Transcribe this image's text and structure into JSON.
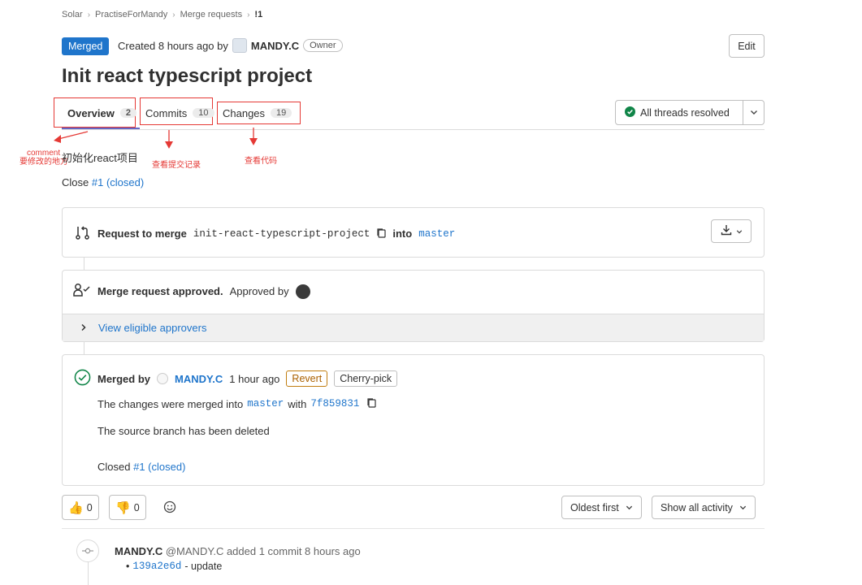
{
  "breadcrumb": [
    "Solar",
    "PractiseForMandy",
    "Merge requests",
    "!1"
  ],
  "header": {
    "status_badge": "Merged",
    "created_text": "Created 8 hours ago by",
    "author": "MANDY.C",
    "role": "Owner",
    "edit_label": "Edit",
    "title": "Init react typescript project"
  },
  "tabs": [
    {
      "label": "Overview",
      "count": "2"
    },
    {
      "label": "Commits",
      "count": "10"
    },
    {
      "label": "Changes",
      "count": "19"
    }
  ],
  "threads_label": "All threads resolved",
  "annotations": {
    "comment_line1": "comment",
    "comment_line2": "要修改的地方",
    "commits_note": "查看提交记录",
    "changes_note": "查看代码"
  },
  "description": "初始化react项目",
  "close_prefix": "Close",
  "close_link": "#1 (closed)",
  "request": {
    "prefix": "Request to merge",
    "source_branch": "init-react-typescript-project",
    "into": "into",
    "target_branch": "master"
  },
  "approval": {
    "title": "Merge request approved.",
    "approved_by": "Approved by",
    "eligible": "View eligible approvers"
  },
  "merged": {
    "merged_by": "Merged by",
    "user": "MANDY.C",
    "time": "1 hour ago",
    "revert_label": "Revert",
    "cherry_label": "Cherry-pick",
    "merged_into_text": "The changes were merged into",
    "target_branch": "master",
    "with_text": "with",
    "commit_sha": "7f859831",
    "source_deleted": "The source branch has been deleted",
    "closed_prefix": "Closed",
    "closed_link": "#1 (closed)"
  },
  "reactions": {
    "thumbs_up": "0",
    "thumbs_down": "0"
  },
  "sort": {
    "order_label": "Oldest first",
    "filter_label": "Show all activity"
  },
  "activity": {
    "user": "MANDY.C",
    "handle": "@MANDY.C",
    "text": "added 1 commit 8 hours ago",
    "commit_sha": "139a2e6d",
    "commit_msg": "- update"
  },
  "colors": {
    "accent": "#1f75cb",
    "annotation": "#e53935",
    "success": "#108548"
  }
}
